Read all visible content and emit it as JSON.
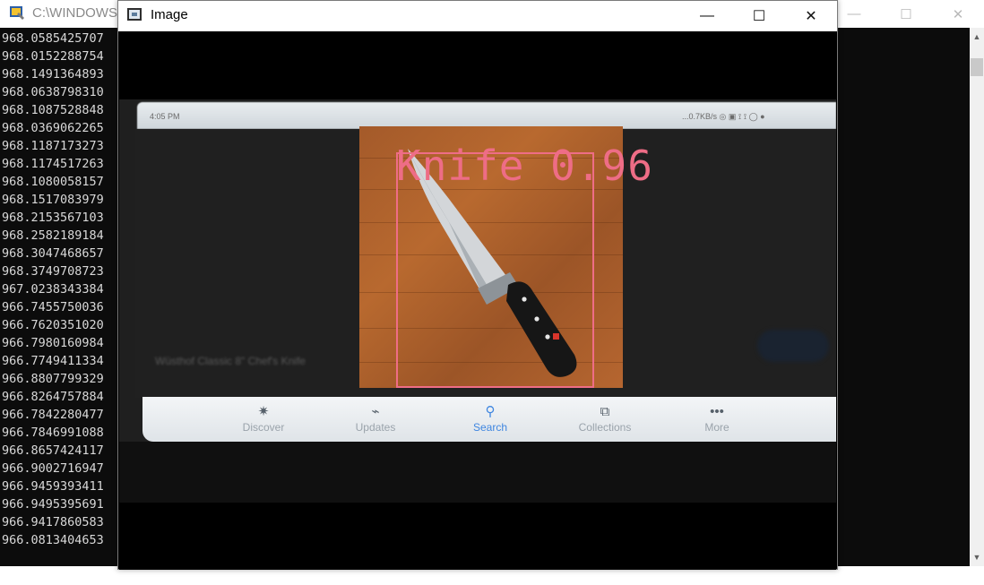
{
  "console": {
    "title": "C:\\WINDOWS\\",
    "lines": [
      "968.0585425707",
      "968.0152288754",
      "968.1491364893",
      "968.0638798310",
      "968.1087528848",
      "968.0369062265",
      "968.1187173273",
      "968.1174517263",
      "968.1080058157",
      "968.1517083979",
      "968.2153567103",
      "968.2582189184",
      "968.3047468657",
      "968.3749708723",
      "967.0238343384",
      "966.7455750036",
      "966.7620351020",
      "966.7980160984",
      "966.7749411334",
      "966.8807799329",
      "966.8264757884",
      "966.7842280477",
      "966.7846991088",
      "966.8657424117",
      "966.9002716947",
      "966.9459393411",
      "966.9495395691",
      "966.9417860583",
      "966.0813404653"
    ],
    "controls": {
      "minimize": "—",
      "maximize": "☐",
      "close": "✕"
    }
  },
  "image_window": {
    "title": "Image",
    "controls": {
      "minimize": "—",
      "maximize": "☐",
      "close": "✕"
    }
  },
  "camera_frame": {
    "status_time": "4:05 PM",
    "status_right": "...0.7KB/s ◎ ▣ ⟟ ⟟ ◯ ●",
    "blurred_text": "Wüsthof Classic 8\" Chef's Knife",
    "nav_items": [
      {
        "icon": "✷",
        "label": "Discover"
      },
      {
        "icon": "⌁",
        "label": "Updates"
      },
      {
        "icon": "⚲",
        "label": "Search"
      },
      {
        "icon": "⧉",
        "label": "Collections"
      },
      {
        "icon": "•••",
        "label": "More"
      }
    ],
    "active_nav": "Search"
  },
  "detection": {
    "class_name": "Knife",
    "confidence": "0.96",
    "label_text": "Knife 0.96",
    "color": "#ee6d86"
  }
}
